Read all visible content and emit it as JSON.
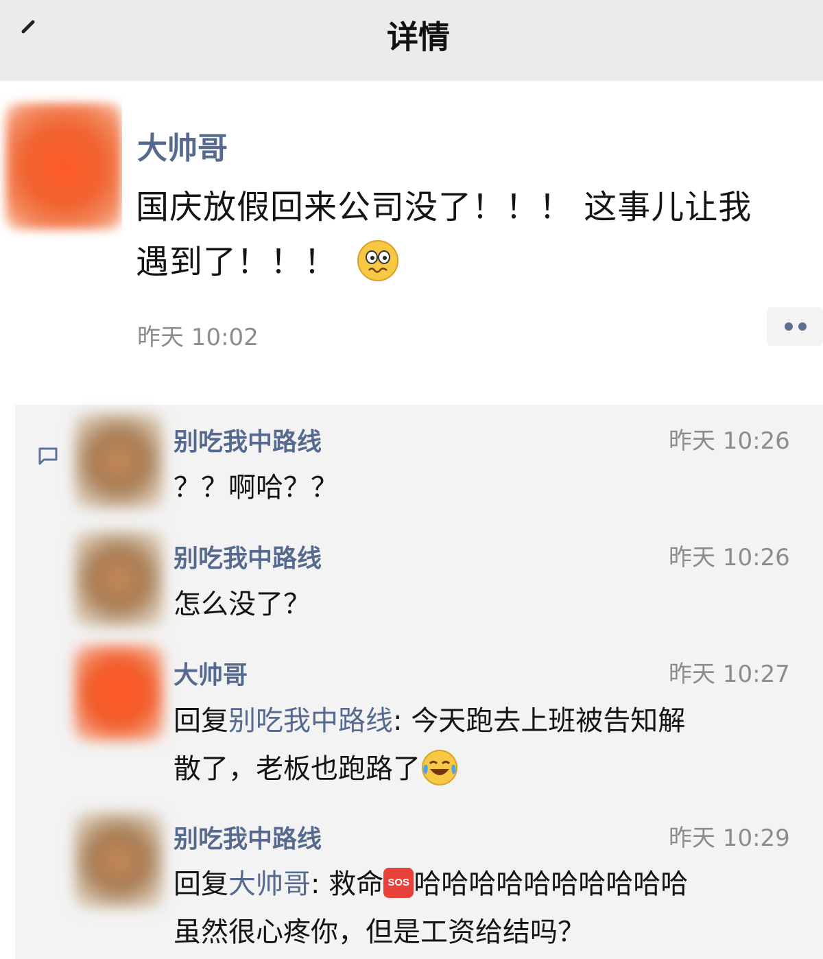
{
  "header": {
    "title": "详情",
    "back_icon": "back-arrow-icon"
  },
  "post": {
    "author": "大帅哥",
    "text_line1": "国庆放假回来公司没了！！！ 这事儿让我",
    "text_line2": "遇到了！！！",
    "emoji": "worried-face-emoji",
    "time": "昨天 10:02",
    "more_icon": "more-dots-icon"
  },
  "comments": [
    {
      "author": "别吃我中路线",
      "time": "昨天 10:26",
      "text": "？？啊哈？？"
    },
    {
      "author": "别吃我中路线",
      "time": "昨天 10:26",
      "text": "怎么没了？"
    },
    {
      "author": "大帅哥",
      "time": "昨天 10:27",
      "reply_prefix": "回复",
      "reply_to": "别吃我中路线",
      "line1_rest": ": 今天跑去上班被告知解",
      "line2": "散了，老板也跑路了",
      "emoji": "laughing-crying-emoji"
    },
    {
      "author": "别吃我中路线",
      "time": "昨天 10:29",
      "reply_prefix": "回复",
      "reply_to": "大帅哥",
      "line1_mid": ": 救命",
      "sos_label": "SOS",
      "line1_rest": "哈哈哈哈哈哈哈哈哈哈",
      "line2": "虽然很心疼你，但是工资给结吗？"
    }
  ],
  "colors": {
    "link": "#566a8f",
    "header_bg": "#ebebeb",
    "comments_bg": "#f3f3f3"
  }
}
